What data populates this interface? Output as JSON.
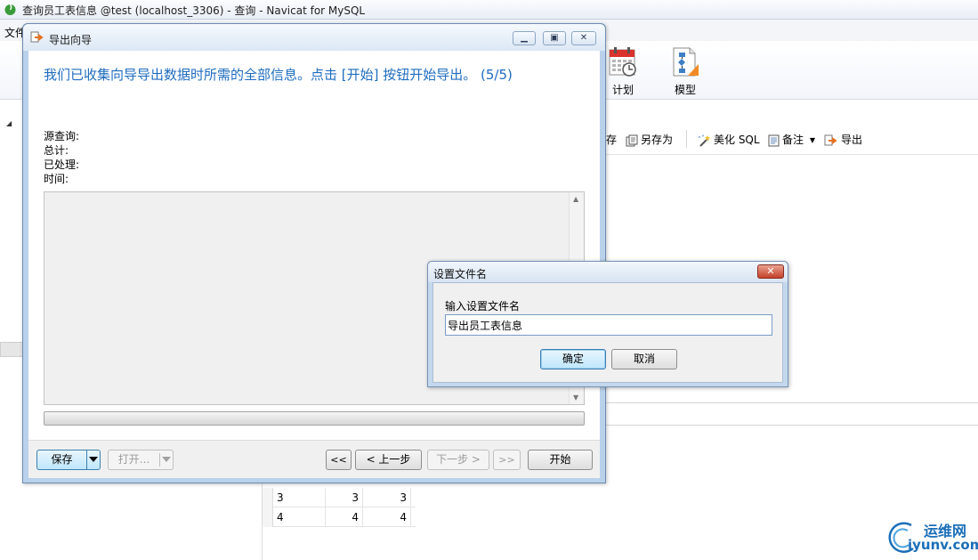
{
  "app": {
    "title": "查询员工表信息 @test (localhost_3306) - 查询 - Navicat for MySQL",
    "menu_file": "文件",
    "toolbar": {
      "plan_label": "计划",
      "model_label": "模型"
    },
    "query_toolbar": {
      "save_partial": "存",
      "save_as": "另存为",
      "beautify_sql": "美化 SQL",
      "comment": "备注",
      "export": "导出"
    },
    "grid_rows": [
      {
        "c1": "3",
        "c2": "3",
        "c3": "3"
      },
      {
        "c1": "4",
        "c2": "4",
        "c3": "4"
      }
    ],
    "watermark": {
      "cn": "运维网",
      "en": "iyunv.com"
    }
  },
  "wizard": {
    "title": "导出向导",
    "heading": "我们已收集向导导出数据时所需的全部信息。点击 [开始] 按钮开始导出。 (5/5)",
    "info": {
      "source": "源查询:",
      "total": "总计:",
      "processed": "已处理:",
      "time": "时间:"
    },
    "progress_fraction": 0,
    "buttons": {
      "save": "保存",
      "open": "打开...",
      "first": "<<",
      "prev": "< 上一步",
      "next": "下一步 >",
      "last": ">>",
      "start": "开始"
    }
  },
  "filename_dialog": {
    "title": "设置文件名",
    "label": "输入设置文件名",
    "value": "导出员工表信息",
    "ok": "确定",
    "cancel": "取消"
  },
  "colors": {
    "heading_blue": "#1f6cbf",
    "close_red": "#c4412b",
    "calendar_red": "#d9332b",
    "model_orange": "#f08a24"
  },
  "icons": {
    "app_logo": "navicat-leaf-icon",
    "plan": "calendar-icon",
    "model": "model-diagram-icon",
    "wizard": "export-arrow-icon"
  }
}
